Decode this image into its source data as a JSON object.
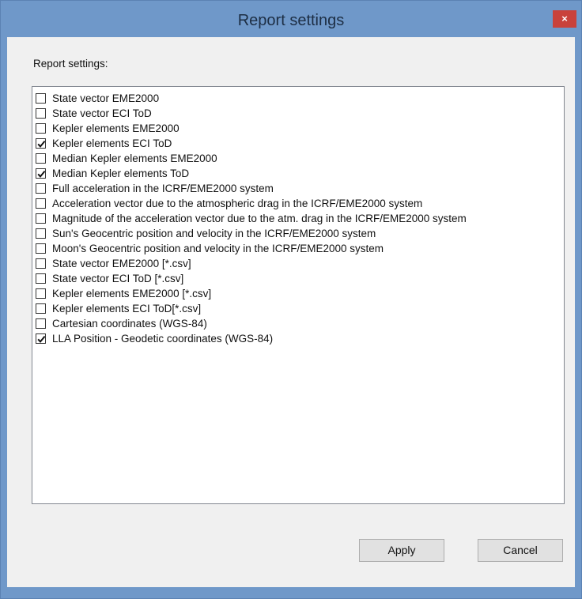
{
  "window": {
    "title": "Report settings",
    "close_glyph": "×",
    "accent_color": "#6f98c9",
    "close_color": "#c9423b"
  },
  "group_label": "Report settings:",
  "items": [
    {
      "label": "State vector EME2000",
      "checked": false
    },
    {
      "label": "State vector ECI ToD",
      "checked": false
    },
    {
      "label": "Kepler elements EME2000",
      "checked": false
    },
    {
      "label": "Kepler elements ECI ToD",
      "checked": true
    },
    {
      "label": "Median Kepler elements EME2000",
      "checked": false
    },
    {
      "label": "Median Kepler elements ToD",
      "checked": true
    },
    {
      "label": "Full acceleration in the ICRF/EME2000 system",
      "checked": false
    },
    {
      "label": "Acceleration  vector due to the atmospheric drag in the ICRF/EME2000 system",
      "checked": false
    },
    {
      "label": "Magnitude of the acceleration vector due to the atm. drag in the ICRF/EME2000 system",
      "checked": false
    },
    {
      "label": "Sun's Geocentric position and velocity in the ICRF/EME2000 system",
      "checked": false
    },
    {
      "label": "Moon's Geocentric position and velocity in the ICRF/EME2000 system",
      "checked": false
    },
    {
      "label": "State vector EME2000 [*.csv]",
      "checked": false
    },
    {
      "label": "State vector ECI ToD [*.csv]",
      "checked": false
    },
    {
      "label": "Kepler elements EME2000 [*.csv]",
      "checked": false
    },
    {
      "label": "Kepler elements ECI ToD[*.csv]",
      "checked": false
    },
    {
      "label": "Cartesian coordinates (WGS-84)",
      "checked": false
    },
    {
      "label": "LLA Position - Geodetic coordinates (WGS-84)",
      "checked": true
    }
  ],
  "buttons": {
    "apply_label": "Apply",
    "cancel_label": "Cancel"
  }
}
